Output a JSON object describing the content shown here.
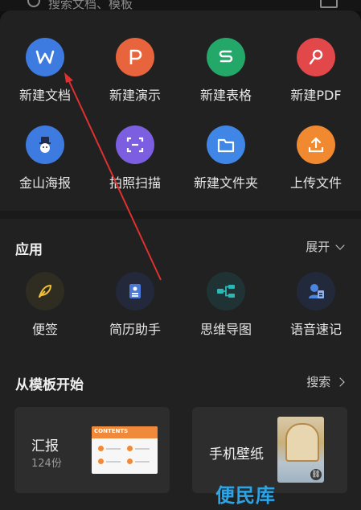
{
  "top": {
    "search_hint": "搜索文档、模板"
  },
  "new_items": [
    {
      "label": "新建文档",
      "icon": "word-icon",
      "color": "#3d7be0"
    },
    {
      "label": "新建演示",
      "icon": "presentation-icon",
      "color": "#e8643c"
    },
    {
      "label": "新建表格",
      "icon": "spreadsheet-icon",
      "color": "#24a86a"
    },
    {
      "label": "新建PDF",
      "icon": "pdf-icon",
      "color": "#e2474a"
    },
    {
      "label": "金山海报",
      "icon": "poster-icon",
      "color": "#3d7be0"
    },
    {
      "label": "拍照扫描",
      "icon": "scan-icon",
      "color": "#7b5fe0"
    },
    {
      "label": "新建文件夹",
      "icon": "folder-icon",
      "color": "#3f86e6"
    },
    {
      "label": "上传文件",
      "icon": "upload-icon",
      "color": "#f0892f"
    }
  ],
  "apps": {
    "title": "应用",
    "expand": "展开",
    "items": [
      {
        "label": "便签",
        "icon": "note-icon",
        "color": "#f0c23a"
      },
      {
        "label": "简历助手",
        "icon": "resume-icon",
        "color": "#4a78d8"
      },
      {
        "label": "思维导图",
        "icon": "mindmap-icon",
        "color": "#2bb7b7"
      },
      {
        "label": "语音速记",
        "icon": "voice-note-icon",
        "color": "#4a86e0"
      }
    ]
  },
  "templates": {
    "title": "从模板开始",
    "search": "搜索",
    "cards": [
      {
        "title": "汇报",
        "count": "124份",
        "thumb_text": "CONTENTS"
      },
      {
        "title": "手机壁纸"
      }
    ]
  },
  "watermark": "便民库"
}
